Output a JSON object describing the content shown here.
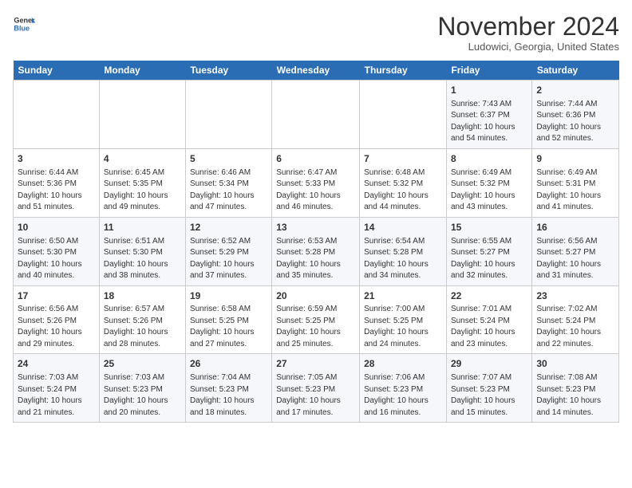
{
  "logo": {
    "line1": "General",
    "line2": "Blue"
  },
  "title": "November 2024",
  "location": "Ludowici, Georgia, United States",
  "weekdays": [
    "Sunday",
    "Monday",
    "Tuesday",
    "Wednesday",
    "Thursday",
    "Friday",
    "Saturday"
  ],
  "weeks": [
    [
      {
        "day": "",
        "info": ""
      },
      {
        "day": "",
        "info": ""
      },
      {
        "day": "",
        "info": ""
      },
      {
        "day": "",
        "info": ""
      },
      {
        "day": "",
        "info": ""
      },
      {
        "day": "1",
        "info": "Sunrise: 7:43 AM\nSunset: 6:37 PM\nDaylight: 10 hours\nand 54 minutes."
      },
      {
        "day": "2",
        "info": "Sunrise: 7:44 AM\nSunset: 6:36 PM\nDaylight: 10 hours\nand 52 minutes."
      }
    ],
    [
      {
        "day": "3",
        "info": "Sunrise: 6:44 AM\nSunset: 5:36 PM\nDaylight: 10 hours\nand 51 minutes."
      },
      {
        "day": "4",
        "info": "Sunrise: 6:45 AM\nSunset: 5:35 PM\nDaylight: 10 hours\nand 49 minutes."
      },
      {
        "day": "5",
        "info": "Sunrise: 6:46 AM\nSunset: 5:34 PM\nDaylight: 10 hours\nand 47 minutes."
      },
      {
        "day": "6",
        "info": "Sunrise: 6:47 AM\nSunset: 5:33 PM\nDaylight: 10 hours\nand 46 minutes."
      },
      {
        "day": "7",
        "info": "Sunrise: 6:48 AM\nSunset: 5:32 PM\nDaylight: 10 hours\nand 44 minutes."
      },
      {
        "day": "8",
        "info": "Sunrise: 6:49 AM\nSunset: 5:32 PM\nDaylight: 10 hours\nand 43 minutes."
      },
      {
        "day": "9",
        "info": "Sunrise: 6:49 AM\nSunset: 5:31 PM\nDaylight: 10 hours\nand 41 minutes."
      }
    ],
    [
      {
        "day": "10",
        "info": "Sunrise: 6:50 AM\nSunset: 5:30 PM\nDaylight: 10 hours\nand 40 minutes."
      },
      {
        "day": "11",
        "info": "Sunrise: 6:51 AM\nSunset: 5:30 PM\nDaylight: 10 hours\nand 38 minutes."
      },
      {
        "day": "12",
        "info": "Sunrise: 6:52 AM\nSunset: 5:29 PM\nDaylight: 10 hours\nand 37 minutes."
      },
      {
        "day": "13",
        "info": "Sunrise: 6:53 AM\nSunset: 5:28 PM\nDaylight: 10 hours\nand 35 minutes."
      },
      {
        "day": "14",
        "info": "Sunrise: 6:54 AM\nSunset: 5:28 PM\nDaylight: 10 hours\nand 34 minutes."
      },
      {
        "day": "15",
        "info": "Sunrise: 6:55 AM\nSunset: 5:27 PM\nDaylight: 10 hours\nand 32 minutes."
      },
      {
        "day": "16",
        "info": "Sunrise: 6:56 AM\nSunset: 5:27 PM\nDaylight: 10 hours\nand 31 minutes."
      }
    ],
    [
      {
        "day": "17",
        "info": "Sunrise: 6:56 AM\nSunset: 5:26 PM\nDaylight: 10 hours\nand 29 minutes."
      },
      {
        "day": "18",
        "info": "Sunrise: 6:57 AM\nSunset: 5:26 PM\nDaylight: 10 hours\nand 28 minutes."
      },
      {
        "day": "19",
        "info": "Sunrise: 6:58 AM\nSunset: 5:25 PM\nDaylight: 10 hours\nand 27 minutes."
      },
      {
        "day": "20",
        "info": "Sunrise: 6:59 AM\nSunset: 5:25 PM\nDaylight: 10 hours\nand 25 minutes."
      },
      {
        "day": "21",
        "info": "Sunrise: 7:00 AM\nSunset: 5:25 PM\nDaylight: 10 hours\nand 24 minutes."
      },
      {
        "day": "22",
        "info": "Sunrise: 7:01 AM\nSunset: 5:24 PM\nDaylight: 10 hours\nand 23 minutes."
      },
      {
        "day": "23",
        "info": "Sunrise: 7:02 AM\nSunset: 5:24 PM\nDaylight: 10 hours\nand 22 minutes."
      }
    ],
    [
      {
        "day": "24",
        "info": "Sunrise: 7:03 AM\nSunset: 5:24 PM\nDaylight: 10 hours\nand 21 minutes."
      },
      {
        "day": "25",
        "info": "Sunrise: 7:03 AM\nSunset: 5:23 PM\nDaylight: 10 hours\nand 20 minutes."
      },
      {
        "day": "26",
        "info": "Sunrise: 7:04 AM\nSunset: 5:23 PM\nDaylight: 10 hours\nand 18 minutes."
      },
      {
        "day": "27",
        "info": "Sunrise: 7:05 AM\nSunset: 5:23 PM\nDaylight: 10 hours\nand 17 minutes."
      },
      {
        "day": "28",
        "info": "Sunrise: 7:06 AM\nSunset: 5:23 PM\nDaylight: 10 hours\nand 16 minutes."
      },
      {
        "day": "29",
        "info": "Sunrise: 7:07 AM\nSunset: 5:23 PM\nDaylight: 10 hours\nand 15 minutes."
      },
      {
        "day": "30",
        "info": "Sunrise: 7:08 AM\nSunset: 5:23 PM\nDaylight: 10 hours\nand 14 minutes."
      }
    ]
  ]
}
